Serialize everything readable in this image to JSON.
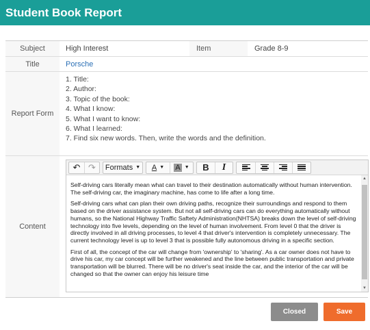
{
  "window": {
    "title": "Student Book Report"
  },
  "form": {
    "subject_label": "Subject",
    "subject_value": "High Interest",
    "item_label": "Item",
    "item_value": "Grade 8-9",
    "title_label": "Title",
    "title_value": "Porsche",
    "report_label": "Report Form",
    "report_items": [
      "1. Title:",
      "2. Author:",
      "3. Topic of the book:",
      "4. What I know:",
      "5. What I want to know:",
      "6. What I learned:",
      "7. Find six new words. Then, write the words and the definition."
    ],
    "content_label": "Content"
  },
  "editor": {
    "toolbar": {
      "undo_icon": "undo-icon",
      "redo_icon": "redo-icon",
      "formats_label": "Formats",
      "text_color_glyph": "A",
      "bg_color_glyph": "A",
      "bold_glyph": "B",
      "italic_glyph": "I"
    },
    "paragraphs": [
      "Self-driving cars literally mean what can travel to their destination automatically without human intervention. The self-driving car, the imaginary machine, has come to life after a long time.",
      "Self-driving cars what can plan their own driving paths, recognize their surroundings and respond to them based on the driver assistance system. But not all self-driving cars can do everything automatically without humans, so the National Highway Traffic Saftety Administration(NHTSA) breaks down the level of self-driving technology into five levels, depending on the level of human involvement. From level 0 that the driver is directly involved in all driving processes, to level 4 that driver's intervention is completely unnecessary. The current technology level is up to level 3 that is possible fully autonomous driving in a specific section.",
      "First of all, the concept of the car will change from 'ownership' to 'sharing'. As a car owner does not have to drive his car, my car concept will be further weakened and the line between public transportation and private transportation will be blurred. There will be no driver's seat inside the car, and the interior of the car will be changed so that the owner can enjoy his leisure time"
    ]
  },
  "buttons": {
    "closed_label": "Closed",
    "save_label": "Save"
  }
}
